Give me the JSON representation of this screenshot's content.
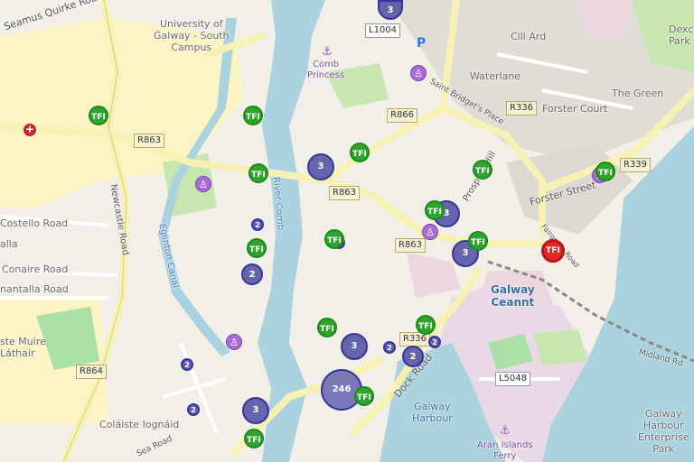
{
  "labels": {
    "university": "University of Galway - South Campus",
    "university_l1": "University of",
    "university_l2": "Galway - South",
    "university_l3": "Campus",
    "seamus": "Seamus Quirke Road",
    "l1004": "L1004",
    "cill_ard": "Cill Ard",
    "waterlane": "Waterlane",
    "comb_princess_l1": "Comb",
    "comb_princess_l2": "Princess",
    "saint_bridgets": "Saint Bridget's Place",
    "r866": "R866",
    "r336_top": "R336",
    "the_green": "The Green",
    "forster_court": "Forster Court",
    "r863_left": "R863",
    "r863_mid": "R863",
    "r863_right": "R863",
    "r339": "R339",
    "prospect_hill": "Prospect Hill",
    "forster_street": "Forster Street",
    "newcastle_road": "Newcastle Road",
    "costello_road": "Costello Road",
    "alla": "alla",
    "conaire_road": "Conaire Road",
    "nantalla_road": "nantalla Road",
    "eglinton_canal": "Eglinton Canal",
    "river_corrib_l1": "River Corrib",
    "galway_ceannt_l1": "Galway",
    "galway_ceannt_l2": "Ceannt",
    "r336_mid": "R336",
    "l5048": "L5048",
    "dock_road": "Dock Road",
    "ste_muire_l1": "ste Muire",
    "ste_muire_l2": "Láthair",
    "r864": "R864",
    "harbour_l1": "Galway",
    "harbour_l2": "Harbour",
    "aran_l1": "Aran Islands",
    "aran_l2": "Ferry",
    "enterprise_l1": "Galway",
    "enterprise_l2": "Harbour",
    "enterprise_l3": "Enterprise",
    "enterprise_l4": "Park",
    "colaiste": "Coláiste Iognáid",
    "sea_road": "Sea Road",
    "dexco_l1": "Dexco",
    "dexco_l2": "Park",
    "midland": "Midland Rd",
    "fairgreen": "Fairgreen Road"
  },
  "markers": {
    "tfi_label": "TFI",
    "clusters": {
      "c1": "3",
      "c2": "3",
      "c3": "3",
      "c4": "3",
      "c5": "2",
      "c6": "2",
      "c7": "2",
      "c8": "2",
      "c9": "2",
      "c10": "3",
      "c11": "3",
      "c12": "246",
      "c13": "2",
      "c14": "2",
      "c15": "3",
      "c16": "2"
    }
  },
  "colors": {
    "water": "#aad3df",
    "park": "#c8e6b0",
    "campus": "#fdf4c5",
    "road_major": "#f7f2b4",
    "tfi": "#2fa52f",
    "tfi_selected": "#e02a2a",
    "cluster": "#4646a0"
  }
}
